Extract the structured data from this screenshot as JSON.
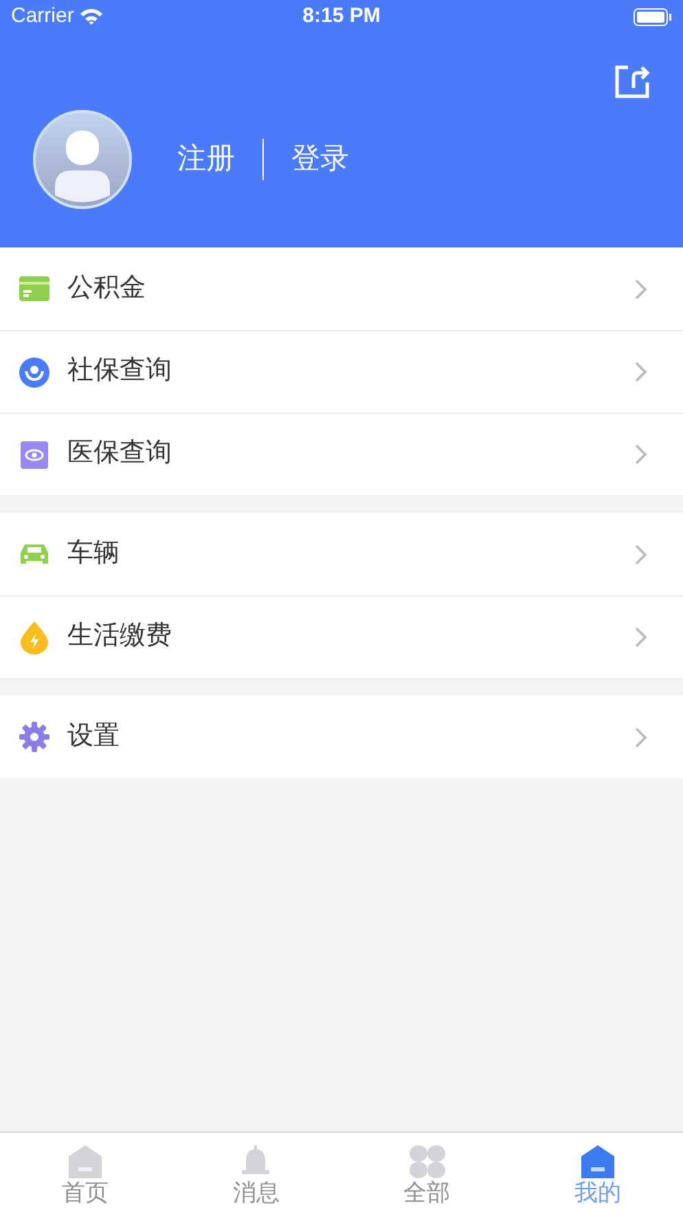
{
  "status_bar": {
    "carrier": "Carrier",
    "time": "8:15 PM"
  },
  "header": {
    "register": "注册",
    "login": "登录"
  },
  "menu_groups": [
    {
      "items": [
        {
          "label": "公积金",
          "kind": "fund"
        },
        {
          "label": "社保查询",
          "kind": "social"
        },
        {
          "label": "医保查询",
          "kind": "medical"
        }
      ]
    },
    {
      "items": [
        {
          "label": "车辆",
          "kind": "car"
        },
        {
          "label": "生活缴费",
          "kind": "bill"
        }
      ]
    },
    {
      "items": [
        {
          "label": "设置",
          "kind": "settings"
        }
      ]
    }
  ],
  "tab_bar": [
    {
      "label": "首页",
      "kind": "home",
      "selected": false
    },
    {
      "label": "消息",
      "kind": "bell",
      "selected": false
    },
    {
      "label": "全部",
      "kind": "all",
      "selected": false
    },
    {
      "label": "我的",
      "kind": "home",
      "selected": true
    }
  ]
}
